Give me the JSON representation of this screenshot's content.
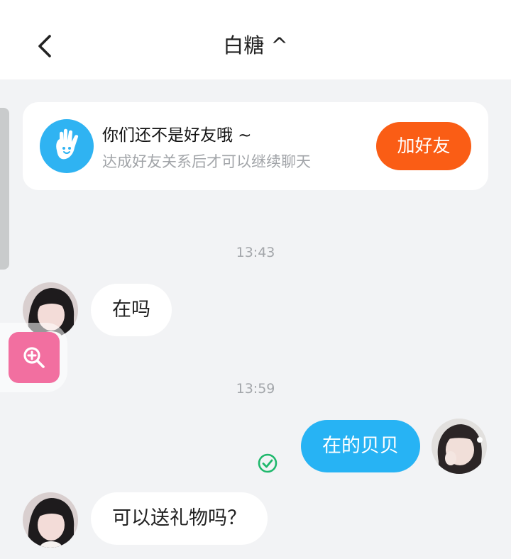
{
  "header": {
    "title": "白糖 ^",
    "back_icon": "chevron-left-icon"
  },
  "friend_prompt": {
    "title": "你们还不是好友哦 ~",
    "subtitle": "达成好友关系后才可以继续聊天",
    "button_label": "加好友",
    "icon": "hand-wave-icon",
    "colors": {
      "button": "#fa5d15",
      "icon_bg": "#2fb3f2"
    }
  },
  "messages": [
    {
      "type": "time",
      "text": "13:43"
    },
    {
      "type": "incoming",
      "text": "在吗"
    },
    {
      "type": "time",
      "text": "13:59"
    },
    {
      "type": "outgoing",
      "text": "在的贝贝",
      "status": "read-check-icon"
    },
    {
      "type": "incoming",
      "text": "可以送礼物吗？"
    }
  ],
  "floating": {
    "zoom_icon": "zoom-in-icon",
    "color": "#f26fa0"
  },
  "colors": {
    "outgoing_bubble": "#27b3f4",
    "incoming_bubble": "#ffffff",
    "background": "#f2f3f5"
  }
}
